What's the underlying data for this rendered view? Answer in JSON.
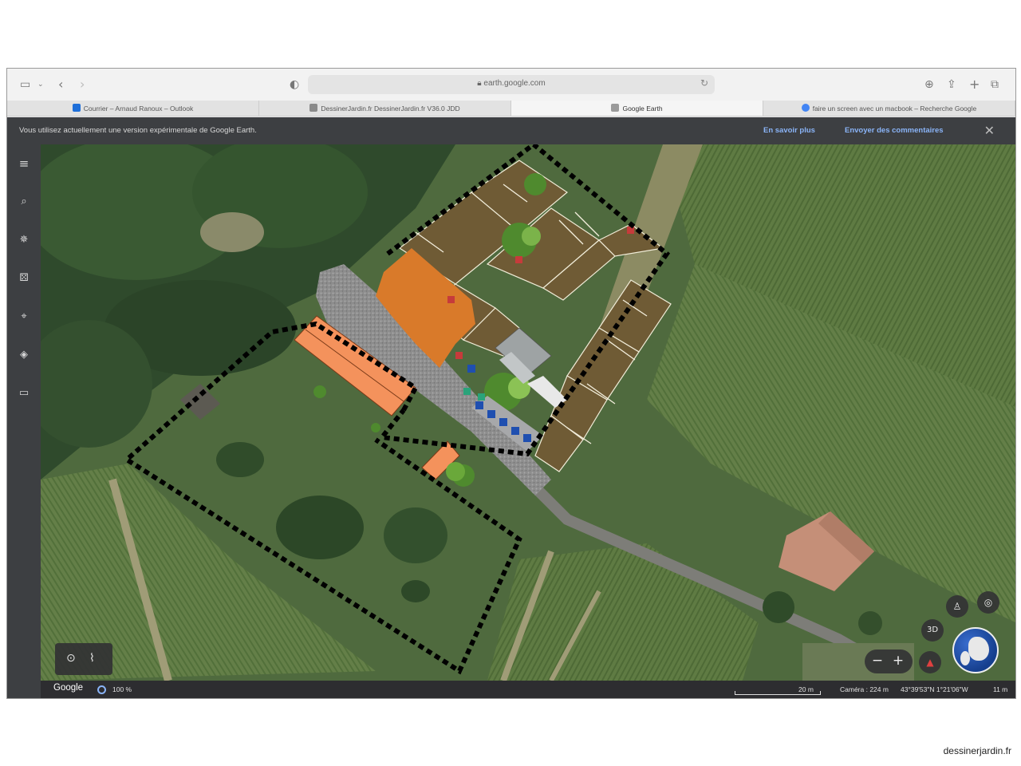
{
  "browser": {
    "url": "earth.google.com",
    "tabs": [
      {
        "label": "Courrier – Arnaud Ranoux – Outlook",
        "favicon_color": "#1e6fd9",
        "active": false
      },
      {
        "label": "DessinerJardin.fr DessinerJardin.fr V36.0 JDD",
        "favicon_color": "#8a8a8a",
        "active": false
      },
      {
        "label": "Google Earth",
        "favicon_color": "#9a9a9a",
        "active": true
      },
      {
        "label": "faire un screen avec un macbook – Recherche Google",
        "favicon_color": "#4285f4",
        "active": false
      }
    ]
  },
  "notice": {
    "text": "Vous utilisez actuellement une version expérimentale de Google Earth.",
    "learn_more": "En savoir plus",
    "feedback": "Envoyer des commentaires"
  },
  "left_toolbar": [
    "menu-icon",
    "search-icon",
    "voyager-icon",
    "feeling-lucky-icon",
    "projects-icon",
    "map-style-icon",
    "measure-icon"
  ],
  "controls": {
    "three_d_label": "3D",
    "zoom_out": "−",
    "zoom_in": "+"
  },
  "status": {
    "logo": "Google",
    "zoom_percent": "100 %",
    "scale": "20 m",
    "camera": "Caméra : 224 m",
    "coordinates": "43°39'53\"N 1°21'06\"W",
    "elevation": "11 m"
  },
  "watermark": "dessinerjardin.fr",
  "colors": {
    "boundary": "#000000",
    "building_roof": "#f4925c",
    "building_orange": "#d97a2a",
    "parcel_brown": "#6f5b35",
    "accent_link": "#8ab4f8"
  }
}
